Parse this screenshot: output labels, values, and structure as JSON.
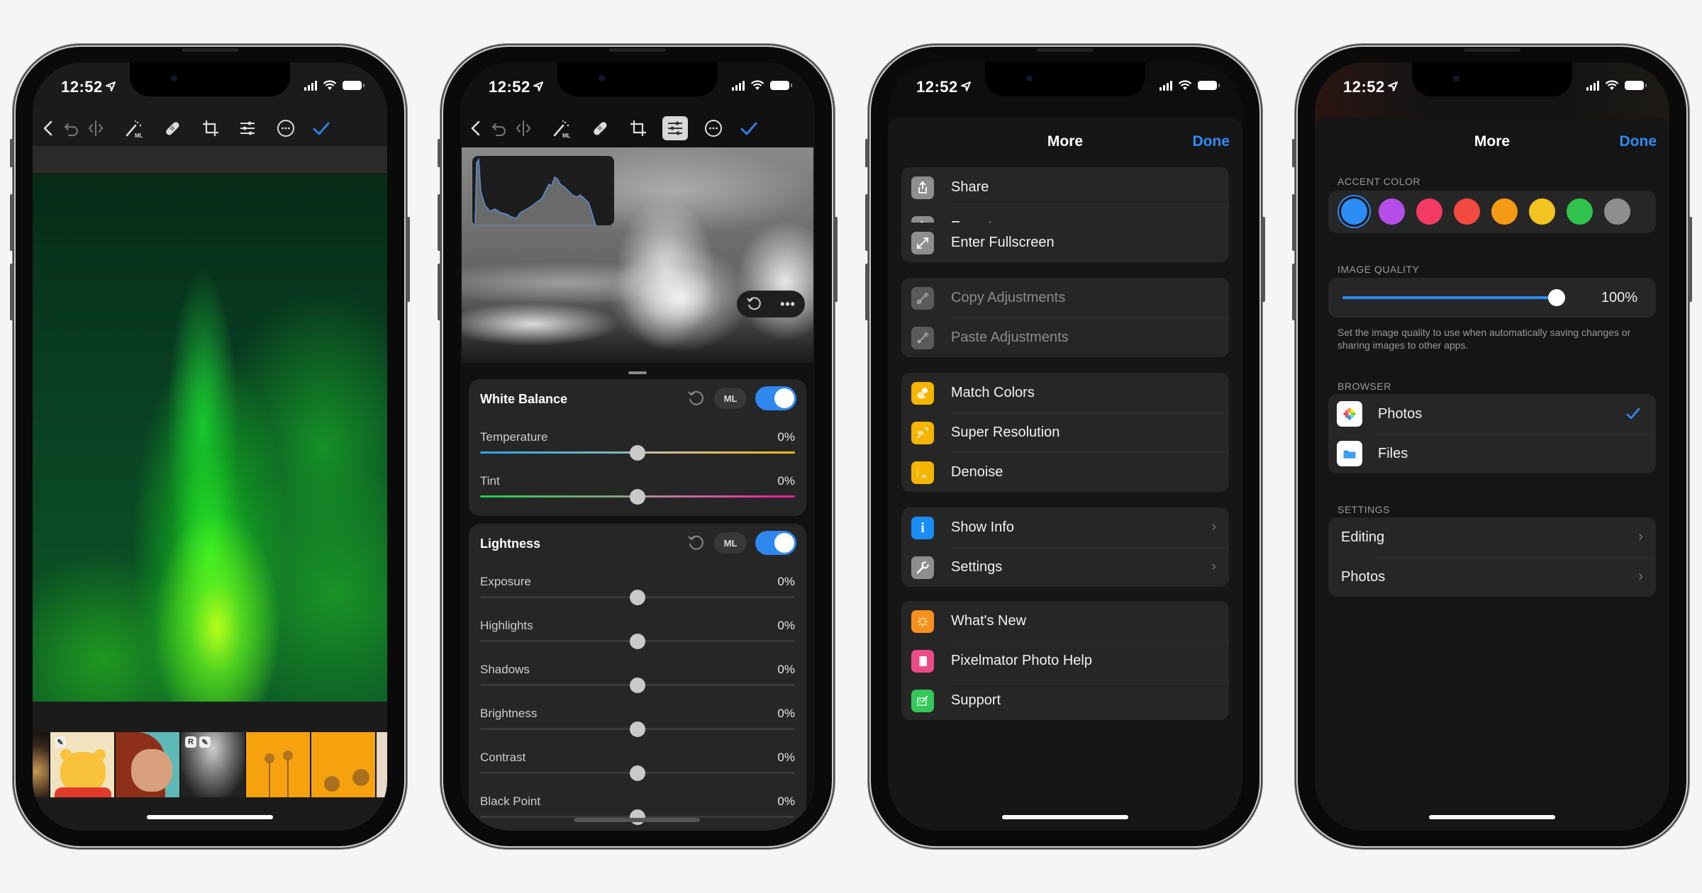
{
  "status_bar": {
    "time": "12:52",
    "location_icon": "location-arrow-icon",
    "signal_icon": "cellular-signal-icon",
    "wifi_icon": "wifi-icon",
    "battery_icon": "battery-icon"
  },
  "editor_toolbar": {
    "items": [
      {
        "name": "back",
        "icon": "chevron-left-icon"
      },
      {
        "name": "undo",
        "icon": "undo-icon"
      },
      {
        "name": "compare",
        "icon": "compare-icon"
      },
      {
        "name": "ml-enhance",
        "icon": "magic-wand-ml-icon"
      },
      {
        "name": "repair",
        "icon": "bandage-icon"
      },
      {
        "name": "crop",
        "icon": "crop-icon"
      },
      {
        "name": "adjust",
        "icon": "sliders-icon"
      },
      {
        "name": "more",
        "icon": "ellipsis-circle-icon"
      },
      {
        "name": "done",
        "icon": "checkmark-icon"
      }
    ],
    "accent": "#2f7fe0"
  },
  "phone1": {
    "photo": "aurora-borealis-photo",
    "thumbnails": [
      {
        "subject": "partial-thumbnail",
        "badges": []
      },
      {
        "subject": "cartoon-bear",
        "badges": [
          "pencil"
        ]
      },
      {
        "subject": "cartoon-woman",
        "badges": []
      },
      {
        "subject": "grayscale-landscape",
        "badges": [
          "R",
          "pencil"
        ]
      },
      {
        "subject": "orange-flowers",
        "badges": []
      },
      {
        "subject": "orange-flowers-2",
        "badges": []
      }
    ]
  },
  "phone2": {
    "photo": "black-and-white-clouds-photo",
    "image_controls": {
      "reset_icon": "reset-icon",
      "more_icon": "ellipsis-icon"
    },
    "cards": [
      {
        "title": "White Balance",
        "ml_label": "ML",
        "enabled": true,
        "sliders": [
          {
            "label": "Temperature",
            "value": "0%",
            "position": 0.5,
            "track": "temperature"
          },
          {
            "label": "Tint",
            "value": "0%",
            "position": 0.5,
            "track": "tint"
          }
        ]
      },
      {
        "title": "Lightness",
        "ml_label": "ML",
        "enabled": true,
        "sliders": [
          {
            "label": "Exposure",
            "value": "0%",
            "position": 0.5
          },
          {
            "label": "Highlights",
            "value": "0%",
            "position": 0.5
          },
          {
            "label": "Shadows",
            "value": "0%",
            "position": 0.5
          },
          {
            "label": "Brightness",
            "value": "0%",
            "position": 0.5
          },
          {
            "label": "Contrast",
            "value": "0%",
            "position": 0.5
          },
          {
            "label": "Black Point",
            "value": "0%",
            "position": 0.5
          }
        ]
      }
    ]
  },
  "phone3": {
    "title": "More",
    "done_label": "Done",
    "groups": [
      [
        {
          "label": "Share",
          "icon": "share-icon",
          "icon_bg": "#8e8e8e",
          "disabled": false,
          "chevron": false
        },
        {
          "label": "Export",
          "icon": "export-icon",
          "icon_bg": "#8e8e8e",
          "disabled": false,
          "chevron": false
        }
      ],
      [
        {
          "label": "Enter Fullscreen",
          "icon": "fullscreen-arrows-icon",
          "icon_bg": "#8e8e8e",
          "disabled": false,
          "chevron": false
        }
      ],
      [
        {
          "label": "Copy Adjustments",
          "icon": "eyedropper-icon",
          "icon_bg": "#5a5a5a",
          "disabled": true,
          "chevron": false
        },
        {
          "label": "Paste Adjustments",
          "icon": "eyedropper-icon",
          "icon_bg": "#5a5a5a",
          "disabled": true,
          "chevron": false
        }
      ],
      [
        {
          "label": "Match Colors",
          "icon": "match-colors-ml-icon",
          "icon_bg": "#f5b400",
          "disabled": false,
          "chevron": false
        },
        {
          "label": "Super Resolution",
          "icon": "super-resolution-ml-icon",
          "icon_bg": "#f5b400",
          "disabled": false,
          "chevron": false
        },
        {
          "label": "Denoise",
          "icon": "denoise-ml-icon",
          "icon_bg": "#f5b400",
          "disabled": false,
          "chevron": false
        }
      ],
      [
        {
          "label": "Show Info",
          "icon": "info-icon",
          "icon_bg": "#1a8cf5",
          "disabled": false,
          "chevron": true
        },
        {
          "label": "Settings",
          "icon": "wrench-icon",
          "icon_bg": "#8e8e8e",
          "disabled": false,
          "chevron": true
        }
      ],
      [
        {
          "label": "What's New",
          "icon": "sparkle-icon",
          "icon_bg": "#f7901e",
          "disabled": false,
          "chevron": false
        },
        {
          "label": "Pixelmator Photo Help",
          "icon": "book-icon",
          "icon_bg": "#ec4c86",
          "disabled": false,
          "chevron": false
        },
        {
          "label": "Support",
          "icon": "support-compose-icon",
          "icon_bg": "#34c759",
          "disabled": false,
          "chevron": false
        }
      ]
    ]
  },
  "phone4": {
    "title": "More",
    "done_label": "Done",
    "accent_color": {
      "label": "ACCENT COLOR",
      "selected": 0,
      "swatches": [
        "#2c8df4",
        "#b54ee8",
        "#f23a63",
        "#f24a40",
        "#f59a14",
        "#f2c41f",
        "#2fc24c",
        "#8e8e8e"
      ]
    },
    "image_quality": {
      "label": "IMAGE QUALITY",
      "value": "100%",
      "fraction": 1.0,
      "description": "Set the image quality to use when automatically saving changes or sharing images to other apps."
    },
    "browser": {
      "label": "BROWSER",
      "items": [
        {
          "label": "Photos",
          "icon": "photos-app-icon",
          "selected": true
        },
        {
          "label": "Files",
          "icon": "files-app-icon",
          "selected": false
        }
      ]
    },
    "settings": {
      "label": "SETTINGS",
      "items": [
        {
          "label": "Editing"
        },
        {
          "label": "Photos"
        }
      ]
    }
  }
}
